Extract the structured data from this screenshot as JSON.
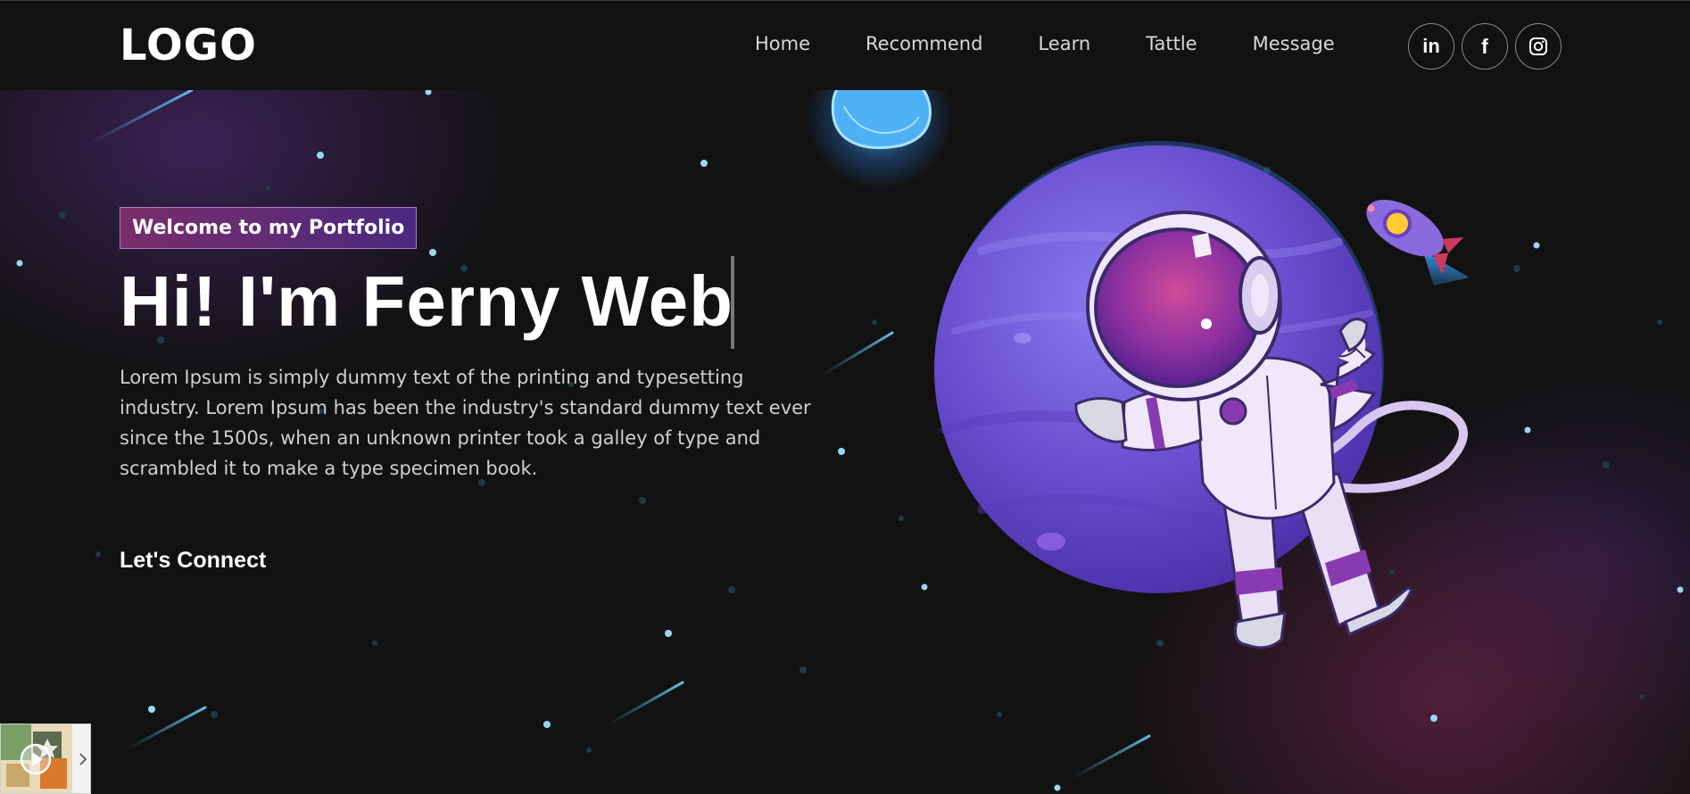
{
  "navbar": {
    "logo": "LOGO",
    "links": [
      {
        "label": "Home"
      },
      {
        "label": "Recommend"
      },
      {
        "label": "Learn"
      },
      {
        "label": "Tattle"
      },
      {
        "label": "Message"
      }
    ],
    "socials": [
      {
        "icon": "linkedin-icon",
        "text": "in"
      },
      {
        "icon": "facebook-icon",
        "text": "f"
      },
      {
        "icon": "instagram-icon"
      }
    ]
  },
  "hero": {
    "tagline": "Welcome to my Portfolio",
    "headline": "Hi! I'm Ferny Web",
    "description": "Lorem Ipsum is simply dummy text of the printing and typesetting industry. Lorem Ipsum has been the industry's standard dummy text ever since the 1500s, when an unknown printer took a galley of type and scrambled it to make a type specimen book.",
    "cta": "Let's Connect"
  },
  "colors": {
    "background": "#121212",
    "accent_purple": "#4b2a80",
    "accent_magenta": "#7a2d6a",
    "planet": "#6a4fd0",
    "star": "#9ad8f0"
  },
  "widget": {
    "icon": "play-icon",
    "arrow_icon": "chevron-right-icon"
  }
}
